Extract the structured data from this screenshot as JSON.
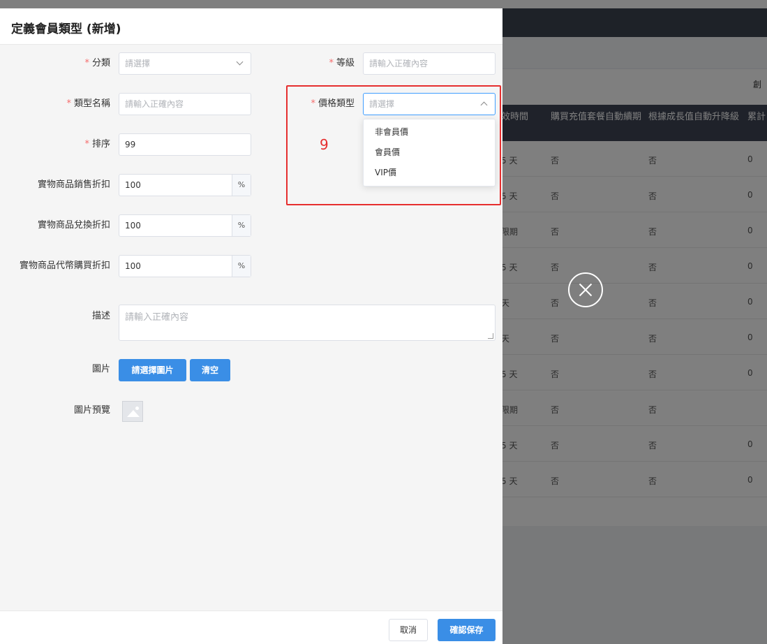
{
  "drawer": {
    "title": "定義會員類型 (新增)"
  },
  "form": {
    "category": {
      "label": "分類",
      "placeholder": "請選擇"
    },
    "level": {
      "label": "等級",
      "placeholder": "請輸入正確內容"
    },
    "type_name": {
      "label": "類型名稱",
      "placeholder": "請輸入正確內容"
    },
    "price_type": {
      "label": "價格類型",
      "placeholder": "請選擇"
    },
    "sort": {
      "label": "排序",
      "value": "99"
    },
    "sale_discount": {
      "label": "實物商品銷售折扣",
      "value": "100",
      "suffix": "%"
    },
    "exchange_discount": {
      "label": "實物商品兌換折扣",
      "value": "100",
      "suffix": "%"
    },
    "coin_discount": {
      "label": "實物商品代幣購買折扣",
      "value": "100",
      "suffix": "%"
    },
    "description": {
      "label": "描述",
      "placeholder": "請輸入正確內容"
    },
    "image": {
      "label": "圖片",
      "choose_label": "請選擇圖片",
      "clear_label": "清空"
    },
    "image_preview": {
      "label": "圖片預覽"
    }
  },
  "price_type_options": [
    "非會員價",
    "會員價",
    "VIP價"
  ],
  "annotation_number": "9",
  "footer": {
    "cancel_label": "取消",
    "save_label": "確認保存"
  },
  "background_table": {
    "top_right_text": "創",
    "headers": [
      "效時間",
      "購買充值套餐自動續期",
      "根據成長值自動升降級",
      "累計"
    ],
    "rows": [
      [
        "5 天",
        "否",
        "否",
        "0"
      ],
      [
        "5 天",
        "否",
        "否",
        "0"
      ],
      [
        "限期",
        "否",
        "否",
        "0"
      ],
      [
        "5 天",
        "否",
        "否",
        "0"
      ],
      [
        "天",
        "否",
        "否",
        "0"
      ],
      [
        "天",
        "否",
        "否",
        "0"
      ],
      [
        "5 天",
        "否",
        "否",
        "0"
      ],
      [
        "限期",
        "否",
        "否",
        ""
      ],
      [
        "5 天",
        "否",
        "否",
        "0"
      ],
      [
        "5 天",
        "否",
        "否",
        "0"
      ]
    ]
  },
  "colors": {
    "primary": "#3a8ee6",
    "required": "#f56c6c",
    "annotation": "#e62e2e"
  }
}
